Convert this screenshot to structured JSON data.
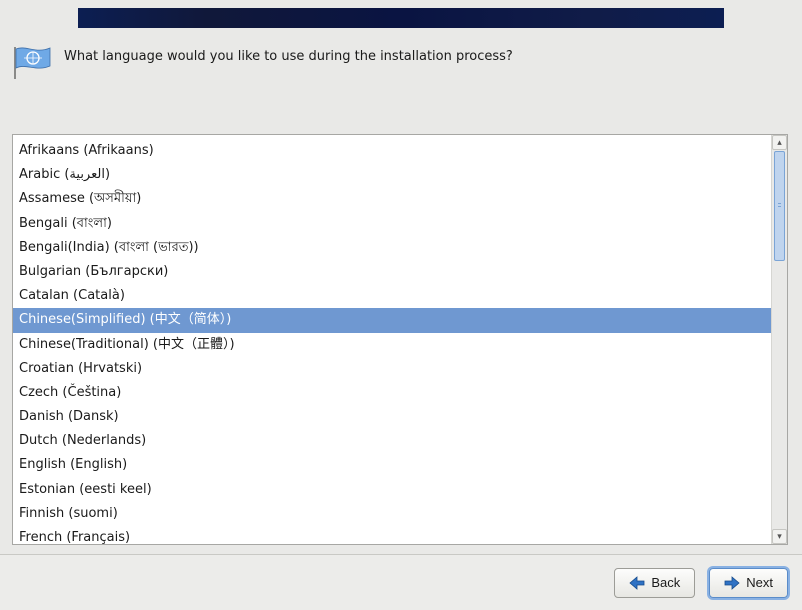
{
  "prompt": "What language would you like to use during the installation process?",
  "languages": [
    {
      "label": "Afrikaans (Afrikaans)",
      "selected": false
    },
    {
      "label": "Arabic (العربية)",
      "selected": false
    },
    {
      "label": "Assamese (অসমীয়া)",
      "selected": false
    },
    {
      "label": "Bengali (বাংলা)",
      "selected": false
    },
    {
      "label": "Bengali(India) (বাংলা (ভারত))",
      "selected": false
    },
    {
      "label": "Bulgarian (Български)",
      "selected": false
    },
    {
      "label": "Catalan (Català)",
      "selected": false
    },
    {
      "label": "Chinese(Simplified) (中文（简体）)",
      "selected": true
    },
    {
      "label": "Chinese(Traditional) (中文（正體）)",
      "selected": false
    },
    {
      "label": "Croatian (Hrvatski)",
      "selected": false
    },
    {
      "label": "Czech (Čeština)",
      "selected": false
    },
    {
      "label": "Danish (Dansk)",
      "selected": false
    },
    {
      "label": "Dutch (Nederlands)",
      "selected": false
    },
    {
      "label": "English (English)",
      "selected": false
    },
    {
      "label": "Estonian (eesti keel)",
      "selected": false
    },
    {
      "label": "Finnish (suomi)",
      "selected": false
    },
    {
      "label": "French (Français)",
      "selected": false
    }
  ],
  "buttons": {
    "back": "Back",
    "next": "Next"
  }
}
